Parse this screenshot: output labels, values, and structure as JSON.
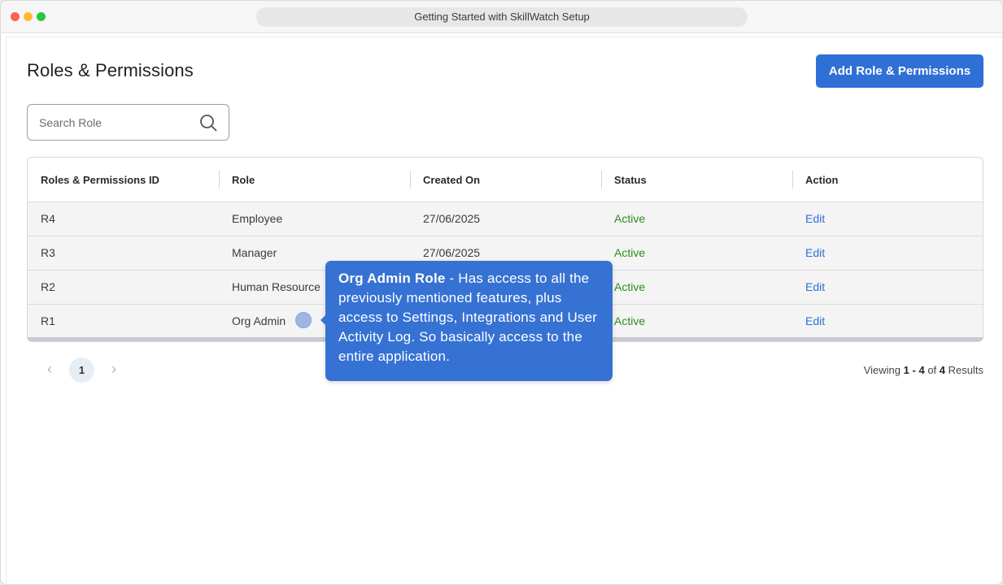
{
  "window": {
    "title": "Getting Started with SkillWatch Setup"
  },
  "page": {
    "title": "Roles & Permissions",
    "add_button_label": "Add Role & Permissions"
  },
  "search": {
    "placeholder": "Search Role",
    "value": ""
  },
  "table": {
    "columns": [
      "Roles & Permissions ID",
      "Role",
      "Created On",
      "Status",
      "Action"
    ],
    "rows": [
      {
        "id": "R4",
        "role": "Employee",
        "created_on": "27/06/2025",
        "status": "Active",
        "action": "Edit"
      },
      {
        "id": "R3",
        "role": "Manager",
        "created_on": "27/06/2025",
        "status": "Active",
        "action": "Edit"
      },
      {
        "id": "R2",
        "role": "Human Resource",
        "created_on": "",
        "status": "Active",
        "action": "Edit"
      },
      {
        "id": "R1",
        "role": "Org Admin",
        "created_on": "",
        "status": "Active",
        "action": "Edit"
      }
    ]
  },
  "pagination": {
    "prev_icon": "chevron-left-icon",
    "current_page": "1",
    "next_icon": "chevron-right-icon",
    "viewing_prefix": "Viewing",
    "range_start": "1",
    "range_sep": "-",
    "range_end": "4",
    "of_label": "of",
    "total": "4",
    "results_label": "Results"
  },
  "tooltip": {
    "title": "Org Admin Role",
    "body": " - Has access to all the previously mentioned features, plus access to Settings, Integrations and User Activity Log. So basically access to the entire application."
  },
  "colors": {
    "accent": "#2f6fd6",
    "tooltip_bg": "#3672d3",
    "status_active": "#2e8b1f"
  }
}
